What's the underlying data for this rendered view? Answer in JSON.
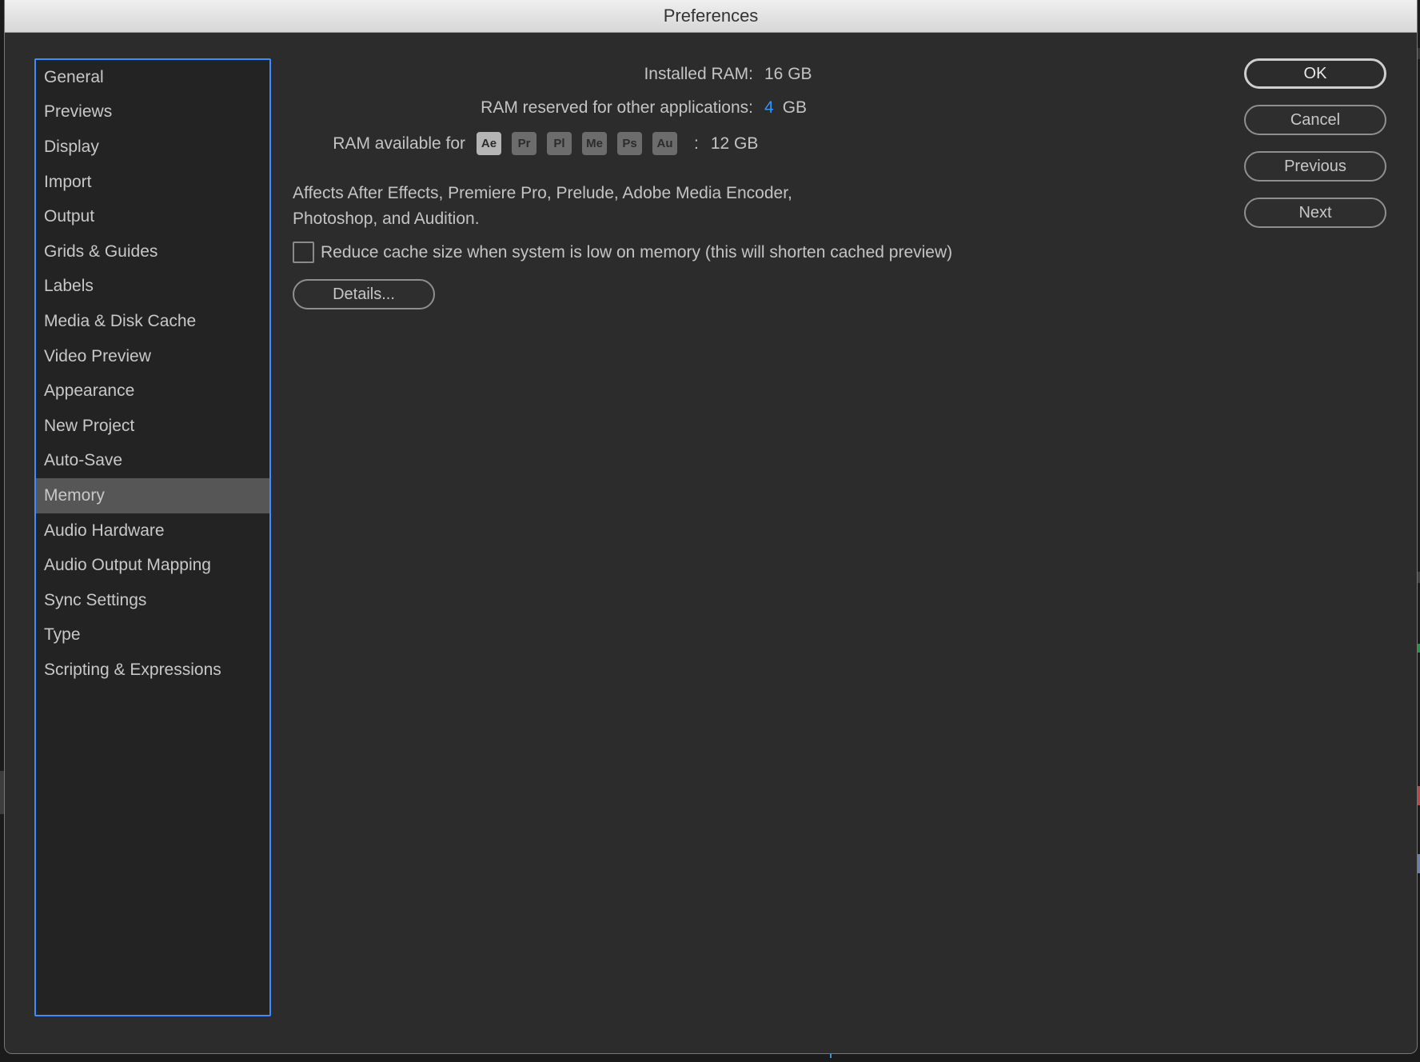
{
  "window": {
    "title": "Preferences"
  },
  "sidebar": {
    "items": [
      {
        "label": "General"
      },
      {
        "label": "Previews"
      },
      {
        "label": "Display"
      },
      {
        "label": "Import"
      },
      {
        "label": "Output"
      },
      {
        "label": "Grids & Guides"
      },
      {
        "label": "Labels"
      },
      {
        "label": "Media & Disk Cache"
      },
      {
        "label": "Video Preview"
      },
      {
        "label": "Appearance"
      },
      {
        "label": "New Project"
      },
      {
        "label": "Auto-Save"
      },
      {
        "label": "Memory",
        "selected": true
      },
      {
        "label": "Audio Hardware"
      },
      {
        "label": "Audio Output Mapping"
      },
      {
        "label": "Sync Settings"
      },
      {
        "label": "Type"
      },
      {
        "label": "Scripting & Expressions"
      }
    ]
  },
  "memory": {
    "installed_label": "Installed RAM:",
    "installed_value": "16 GB",
    "reserved_label": "RAM reserved for other applications:",
    "reserved_value": "4",
    "reserved_unit": "GB",
    "available_label": "RAM available for",
    "available_value": "12 GB",
    "apps": [
      {
        "code": "Ae",
        "active": true,
        "name": "After Effects"
      },
      {
        "code": "Pr",
        "active": false,
        "name": "Premiere Pro"
      },
      {
        "code": "Pl",
        "active": false,
        "name": "Prelude"
      },
      {
        "code": "Me",
        "active": false,
        "name": "Media Encoder"
      },
      {
        "code": "Ps",
        "active": false,
        "name": "Photoshop"
      },
      {
        "code": "Au",
        "active": false,
        "name": "Audition"
      }
    ],
    "affects_line1": "Affects After Effects, Premiere Pro, Prelude, Adobe Media Encoder,",
    "affects_line2": "Photoshop, and Audition.",
    "reduce_cache_label": "Reduce cache size when system is low on memory (this will shorten cached preview)",
    "reduce_cache_checked": false,
    "details_label": "Details..."
  },
  "buttons": {
    "ok": "OK",
    "cancel": "Cancel",
    "previous": "Previous",
    "next": "Next"
  }
}
